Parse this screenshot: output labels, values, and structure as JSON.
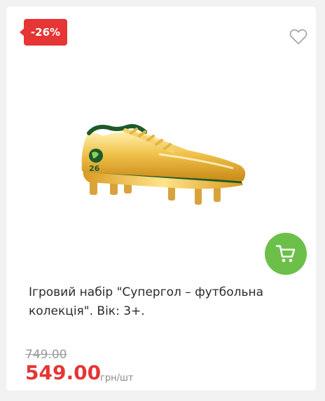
{
  "badge": {
    "discount": "-26%"
  },
  "product": {
    "title": "Ігровий набір \"Супергол – футбольна колекція\". Вік: 3+.",
    "image_icon": "football-boot-image"
  },
  "price": {
    "old": "749.00",
    "current": "549.00",
    "unit": "грн/шт"
  },
  "icons": {
    "wishlist": "heart-icon",
    "cart": "cart-icon"
  },
  "colors": {
    "accent_red": "#e53535",
    "cart_green": "#6cc04a"
  }
}
